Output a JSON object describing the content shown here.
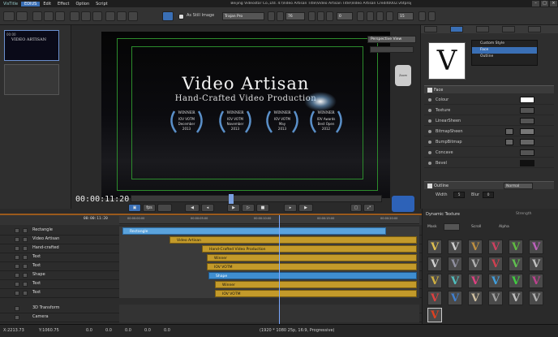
{
  "menubar": {
    "app": "VisTitle",
    "menus": [
      "EDIUS",
      "Edit",
      "Effect",
      "Option",
      "Script"
    ],
    "path": "Beijing Videostar Co.,Ltd. 4:\\Video Artisan Title\\Video Artisan Title\\Video Artisan Credit0002.vtitproj"
  },
  "toolbar": {
    "still_image_label": "As Still Image",
    "font_name": "Trajan Pro",
    "font_size": "76",
    "char_spacing": "0",
    "zoom": "15"
  },
  "thumbnails": [
    {
      "label": "00:00",
      "caption": "VIDEO ARTISAN"
    }
  ],
  "preview": {
    "title": "Video Artisan",
    "subtitle": "Hand-Crafted Video Production",
    "awards": [
      {
        "line1": "WINNER",
        "line2": "IOV VOTM",
        "line3": "December",
        "line4": "2013"
      },
      {
        "line1": "WINNER",
        "line2": "IOV VOTM",
        "line3": "November",
        "line4": "2013"
      },
      {
        "line1": "WINNER",
        "line2": "IOV VOTM",
        "line3": "May",
        "line4": "2013"
      },
      {
        "line1": "WINNER",
        "line2": "IOV Awards",
        "line3": "Best Open",
        "line4": "2012"
      }
    ],
    "perspective_label": "Perspective View",
    "zoom_thumb": "Zoom",
    "timecode": "00:00:11:20",
    "transport_time_label": "00:00:11:20"
  },
  "rightpanel": {
    "style_preview_letter": "V",
    "style_list": [
      "Custom Style",
      "Face",
      "Outline"
    ],
    "face_label": "Face",
    "props": [
      "Colour",
      "Texture",
      "LinearSheen",
      "BitmapSheen",
      "BumpBitmap",
      "Concave",
      "Bevel"
    ],
    "outline_label": "Outline",
    "outline_mode": "Normal",
    "width_label": "Width",
    "width_value": "5",
    "blur_label": "Blur",
    "blur_value": "0",
    "colors": {
      "colour": "#ffffff",
      "bevel": "#111111"
    }
  },
  "timeline": {
    "time": "00:00:11:20",
    "ruler": [
      "00:00:00:00",
      "00:00:05:00",
      "00:00:10:00",
      "00:00:15:00",
      "00:00:20:00"
    ],
    "tracks": [
      {
        "name": "Rectangle",
        "clip": "Rectangle",
        "color": "lightblue"
      },
      {
        "name": "Video Artisan",
        "clip": "Video Artisan",
        "color": "gold"
      },
      {
        "name": "Hand-crafted",
        "clip": "Hand-Crafted Video Production",
        "color": "gold"
      },
      {
        "name": "Text",
        "clip": "Winner",
        "color": "gold"
      },
      {
        "name": "Text",
        "clip": "IOV VOTM",
        "color": "gold"
      },
      {
        "name": "Shape",
        "clip": "Shape",
        "color": "blue"
      },
      {
        "name": "Text",
        "clip": "Winner",
        "color": "gold"
      },
      {
        "name": "Text",
        "clip": "IOV VOTM",
        "color": "gold"
      },
      {
        "name": "3D Transform",
        "clip": "",
        "color": "none"
      },
      {
        "name": "Camera",
        "clip": "",
        "color": "none"
      }
    ]
  },
  "palette": {
    "title": "Dynamic Texture",
    "strength_label": "Strength",
    "mask_label": "Mask",
    "scroll_label": "Scroll",
    "alpha_label": "Alpha",
    "cell_letter": "V",
    "cell_colors": [
      "#e0c050",
      "#d0d0d0",
      "#c09040",
      "#d04060",
      "#60c040",
      "#c060c0",
      "#d0d0d0",
      "#9090a0",
      "#b0b0b0",
      "#d04050",
      "#60c050",
      "#c0c0c0",
      "#d0b040",
      "#50c0c0",
      "#e04080",
      "#40a0e0",
      "#40d040",
      "#c04090",
      "#e04040",
      "#4080d0",
      "#d0c0a0",
      "#a0a0a0",
      "#c0c0c0",
      "#b0b0b0"
    ]
  },
  "status": {
    "x": "X:2213.73",
    "y": "Y:1060.75",
    "v1": "0.0",
    "v2": "0.0",
    "v3": "0.0",
    "v4": "0.0",
    "v5": "0.0",
    "format": "(1920 * 1080 25p, 16:9, Progressive)"
  }
}
